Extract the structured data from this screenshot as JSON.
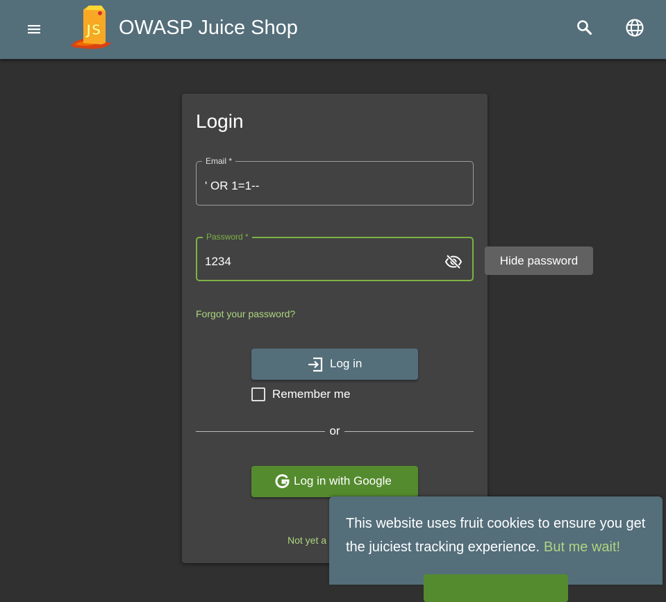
{
  "header": {
    "title": "OWASP Juice Shop",
    "menu_icon": "menu-icon",
    "search_icon": "search-icon",
    "language_icon": "globe-icon",
    "logo": "juice-shop-logo"
  },
  "login": {
    "title": "Login",
    "email": {
      "label": "Email *",
      "value": "' OR 1=1--"
    },
    "password": {
      "label": "Password *",
      "value": "1234",
      "visibility_icon": "eye-off-icon"
    },
    "tooltip": "Hide password",
    "forgot_link": "Forgot your password?",
    "login_button": "Log in",
    "login_icon": "login-icon",
    "remember_me": {
      "label": "Remember me",
      "checked": false
    },
    "divider_text": "or",
    "google_button": "Log in with Google",
    "google_icon": "google-icon",
    "register_link": "Not yet a"
  },
  "cookie_banner": {
    "message": "This website uses fruit cookies to ensure you get the juiciest tracking experience.",
    "link": "But me wait!"
  },
  "colors": {
    "toolbar": "#546e7a",
    "background": "#303030",
    "card": "#424242",
    "accent_green": "#558b2f",
    "link_green": "#aed581",
    "focus_green": "#7cb342"
  }
}
